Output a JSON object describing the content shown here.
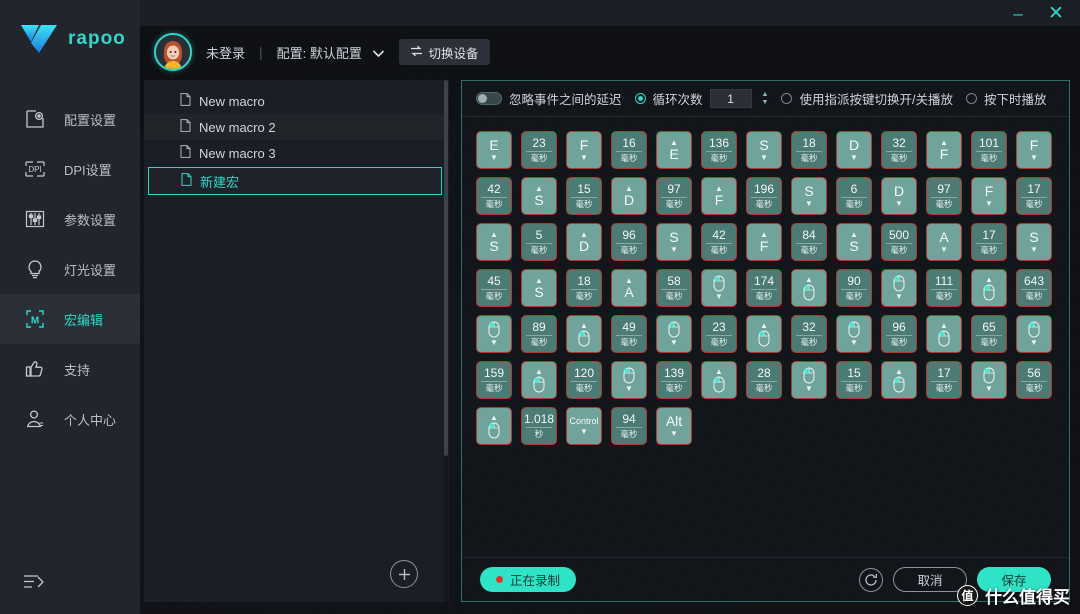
{
  "window": {
    "minimize": "–",
    "close": "✕"
  },
  "brand": {
    "name": "rapoo",
    "logo_icon": "rapoo-v-logo"
  },
  "sidebar": {
    "items": [
      {
        "label": "配置设置",
        "icon": "profile-settings-icon",
        "active": false
      },
      {
        "label": "DPI设置",
        "icon": "dpi-icon",
        "active": false
      },
      {
        "label": "参数设置",
        "icon": "sliders-icon",
        "active": false
      },
      {
        "label": "灯光设置",
        "icon": "bulb-icon",
        "active": false
      },
      {
        "label": "宏编辑",
        "icon": "macro-m-icon",
        "active": true
      },
      {
        "label": "支持",
        "icon": "thumbs-up-icon",
        "active": false
      },
      {
        "label": "个人中心",
        "icon": "user-icon",
        "active": false
      }
    ],
    "collapse_icon": "collapse-menu-icon"
  },
  "topbar": {
    "avatar_icon": "user-avatar",
    "login_status": "未登录",
    "separator": "|",
    "profile_label": "配置: 默认配置",
    "dropdown_icon": "chevron-down-icon",
    "switch_device": "切换设备",
    "switch_device_icon": "switch-arrows-icon"
  },
  "macro_list": {
    "items": [
      {
        "label": "New macro",
        "selected": false
      },
      {
        "label": "New macro 2",
        "selected": false
      },
      {
        "label": "New macro 3",
        "selected": false
      },
      {
        "label": "新建宏",
        "selected": true
      }
    ],
    "add_button_icon": "plus-icon",
    "add_button_label": "+"
  },
  "options": {
    "ignore_delay_label": "忽略事件之间的延迟",
    "ignore_delay_on": false,
    "loop_count_label": "循环次数",
    "loop_count_selected": true,
    "loop_count_value": "1",
    "toggle_playback_label": "使用指派按键切换开/关播放",
    "toggle_playback_selected": false,
    "play_on_press_label": "按下时播放",
    "play_on_press_selected": false,
    "spin_up": "▲",
    "spin_down": "▼"
  },
  "units": {
    "ms": "毫秒",
    "s": "秒"
  },
  "macro_events": [
    {
      "type": "key",
      "key": "E",
      "dir": "down"
    },
    {
      "type": "delay",
      "value": "23",
      "unit": "毫秒"
    },
    {
      "type": "key",
      "key": "F",
      "dir": "down"
    },
    {
      "type": "delay",
      "value": "16",
      "unit": "毫秒"
    },
    {
      "type": "key",
      "key": "E",
      "dir": "up"
    },
    {
      "type": "delay",
      "value": "136",
      "unit": "毫秒"
    },
    {
      "type": "key",
      "key": "S",
      "dir": "down"
    },
    {
      "type": "delay",
      "value": "18",
      "unit": "毫秒"
    },
    {
      "type": "key",
      "key": "D",
      "dir": "down"
    },
    {
      "type": "delay",
      "value": "32",
      "unit": "毫秒"
    },
    {
      "type": "key",
      "key": "F",
      "dir": "up"
    },
    {
      "type": "delay",
      "value": "101",
      "unit": "毫秒"
    },
    {
      "type": "key",
      "key": "F",
      "dir": "down"
    },
    {
      "type": "delay",
      "value": "42",
      "unit": "毫秒"
    },
    {
      "type": "key",
      "key": "S",
      "dir": "up"
    },
    {
      "type": "delay",
      "value": "15",
      "unit": "毫秒"
    },
    {
      "type": "key",
      "key": "D",
      "dir": "up"
    },
    {
      "type": "delay",
      "value": "97",
      "unit": "毫秒"
    },
    {
      "type": "key",
      "key": "F",
      "dir": "up"
    },
    {
      "type": "delay",
      "value": "196",
      "unit": "毫秒"
    },
    {
      "type": "key",
      "key": "S",
      "dir": "down"
    },
    {
      "type": "delay",
      "value": "6",
      "unit": "毫秒"
    },
    {
      "type": "key",
      "key": "D",
      "dir": "down"
    },
    {
      "type": "delay",
      "value": "97",
      "unit": "毫秒"
    },
    {
      "type": "key",
      "key": "F",
      "dir": "down"
    },
    {
      "type": "delay",
      "value": "17",
      "unit": "毫秒"
    },
    {
      "type": "key",
      "key": "S",
      "dir": "up"
    },
    {
      "type": "delay",
      "value": "5",
      "unit": "毫秒"
    },
    {
      "type": "key",
      "key": "D",
      "dir": "up"
    },
    {
      "type": "delay",
      "value": "96",
      "unit": "毫秒"
    },
    {
      "type": "key",
      "key": "S",
      "dir": "down"
    },
    {
      "type": "delay",
      "value": "42",
      "unit": "毫秒"
    },
    {
      "type": "key",
      "key": "F",
      "dir": "up"
    },
    {
      "type": "delay",
      "value": "84",
      "unit": "毫秒"
    },
    {
      "type": "key",
      "key": "S",
      "dir": "up"
    },
    {
      "type": "delay",
      "value": "500",
      "unit": "毫秒"
    },
    {
      "type": "key",
      "key": "A",
      "dir": "down"
    },
    {
      "type": "delay",
      "value": "17",
      "unit": "毫秒"
    },
    {
      "type": "key",
      "key": "S",
      "dir": "down"
    },
    {
      "type": "delay",
      "value": "45",
      "unit": "毫秒"
    },
    {
      "type": "key",
      "key": "S",
      "dir": "up"
    },
    {
      "type": "delay",
      "value": "18",
      "unit": "毫秒"
    },
    {
      "type": "key",
      "key": "A",
      "dir": "up"
    },
    {
      "type": "delay",
      "value": "58",
      "unit": "毫秒"
    },
    {
      "type": "mouse",
      "button": "left",
      "dir": "down"
    },
    {
      "type": "delay",
      "value": "174",
      "unit": "毫秒"
    },
    {
      "type": "mouse",
      "button": "left",
      "dir": "up"
    },
    {
      "type": "delay",
      "value": "90",
      "unit": "毫秒"
    },
    {
      "type": "mouse",
      "button": "left",
      "dir": "down"
    },
    {
      "type": "delay",
      "value": "111",
      "unit": "毫秒"
    },
    {
      "type": "mouse",
      "button": "left",
      "dir": "up"
    },
    {
      "type": "delay",
      "value": "643",
      "unit": "毫秒"
    },
    {
      "type": "mouse",
      "button": "left",
      "dir": "down"
    },
    {
      "type": "delay",
      "value": "89",
      "unit": "毫秒"
    },
    {
      "type": "mouse",
      "button": "left",
      "dir": "up"
    },
    {
      "type": "delay",
      "value": "49",
      "unit": "毫秒"
    },
    {
      "type": "mouse",
      "button": "left",
      "dir": "down"
    },
    {
      "type": "delay",
      "value": "23",
      "unit": "毫秒"
    },
    {
      "type": "mouse",
      "button": "left",
      "dir": "up"
    },
    {
      "type": "delay",
      "value": "32",
      "unit": "毫秒"
    },
    {
      "type": "mouse",
      "button": "left",
      "dir": "down"
    },
    {
      "type": "delay",
      "value": "96",
      "unit": "毫秒"
    },
    {
      "type": "mouse",
      "button": "left",
      "dir": "up"
    },
    {
      "type": "delay",
      "value": "65",
      "unit": "毫秒"
    },
    {
      "type": "mouse",
      "button": "left",
      "dir": "down"
    },
    {
      "type": "delay",
      "value": "159",
      "unit": "毫秒"
    },
    {
      "type": "mouse",
      "button": "left",
      "dir": "up"
    },
    {
      "type": "delay",
      "value": "120",
      "unit": "毫秒"
    },
    {
      "type": "mouse",
      "button": "left",
      "dir": "down"
    },
    {
      "type": "delay",
      "value": "139",
      "unit": "毫秒"
    },
    {
      "type": "mouse",
      "button": "left",
      "dir": "up"
    },
    {
      "type": "delay",
      "value": "28",
      "unit": "毫秒"
    },
    {
      "type": "mouse",
      "button": "left",
      "dir": "down"
    },
    {
      "type": "delay",
      "value": "15",
      "unit": "毫秒"
    },
    {
      "type": "mouse",
      "button": "left",
      "dir": "up"
    },
    {
      "type": "delay",
      "value": "17",
      "unit": "毫秒"
    },
    {
      "type": "mouse",
      "button": "left",
      "dir": "down"
    },
    {
      "type": "delay",
      "value": "56",
      "unit": "毫秒"
    },
    {
      "type": "mouse",
      "button": "left",
      "dir": "up"
    },
    {
      "type": "delay",
      "value": "1.018",
      "unit": "秒"
    },
    {
      "type": "key",
      "key": "Control",
      "dir": "down",
      "small": true
    },
    {
      "type": "delay",
      "value": "94",
      "unit": "毫秒"
    },
    {
      "type": "key",
      "key": "Alt",
      "dir": "down"
    }
  ],
  "footer": {
    "recording_label": "正在录制",
    "recording_dot_color": "#e0362c",
    "reload_icon": "refresh-icon",
    "cancel_label": "取消",
    "save_label": "保存"
  },
  "watermark": {
    "badge": "值",
    "text": "什么值得买"
  },
  "colors": {
    "accent": "#2fd8c8",
    "cell_fill": "#6fa39c",
    "cell_delay_fill": "#4c7b76",
    "cell_border": "#b03a2e",
    "sidebar_bg": "#22252b",
    "panel_bg": "#1b1e24"
  }
}
